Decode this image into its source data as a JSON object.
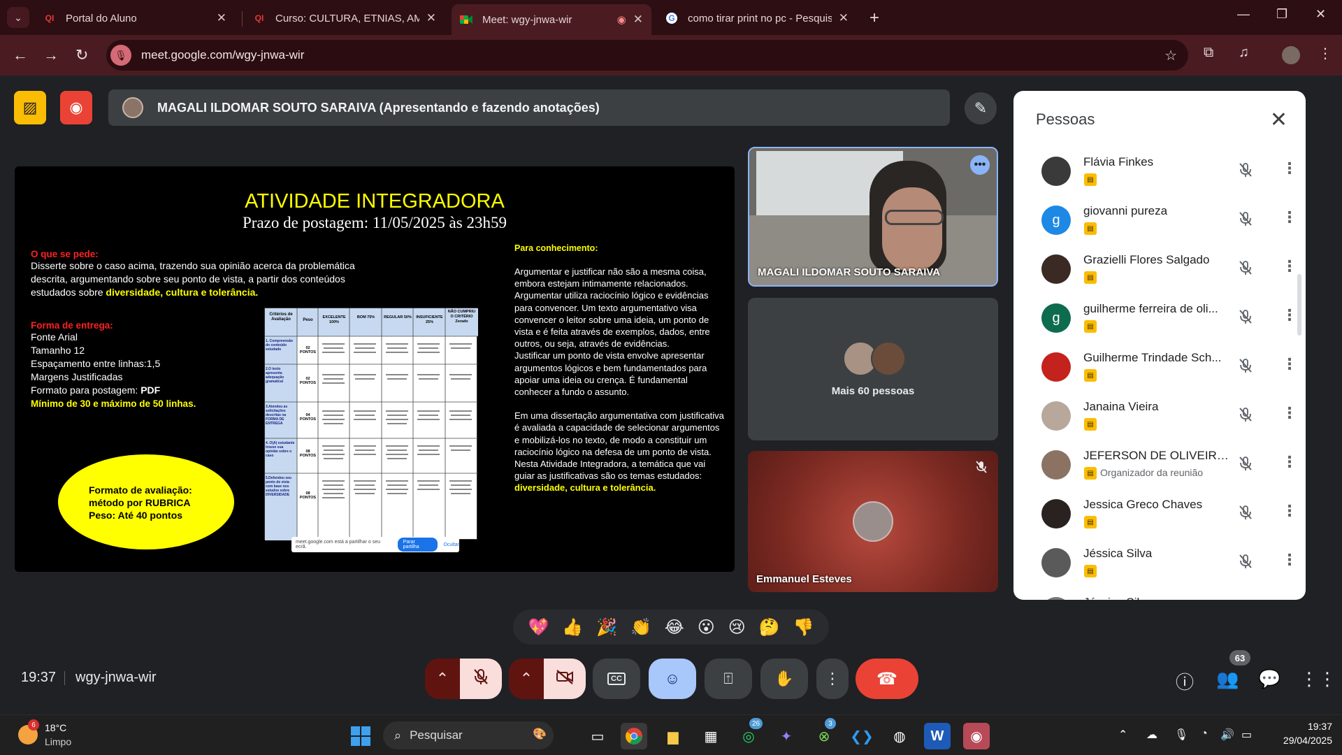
{
  "browser": {
    "tabs": [
      {
        "title": "Portal do Aluno",
        "favicon": "QI"
      },
      {
        "title": "Curso: CULTURA, ETNIAS, AMBI",
        "favicon": "QI"
      },
      {
        "title": "Meet: wgy-jnwa-wir",
        "favicon": "meet"
      },
      {
        "title": "como tirar print no pc - Pesquis",
        "favicon": "G"
      }
    ],
    "url": "meet.google.com/wgy-jnwa-wir"
  },
  "meet": {
    "presenter_text": "MAGALI ILDOMAR SOUTO SARAIVA (Apresentando e fazendo anotações)",
    "meeting_code": "wgy-jnwa-wir",
    "time": "19:37",
    "participant_count": "63"
  },
  "slide": {
    "title": "ATIVIDADE INTEGRADORA",
    "subtitle": "Prazo de postagem: 11/05/2025 às 23h59",
    "o_que_se_pede_label": "O que se pede:",
    "o_que_se_pede_text": "Disserte sobre o caso acima, trazendo sua opinião acerca da problemática descrita, argumentando sobre seu ponto de vista, a partir dos conteúdos estudados sobre",
    "o_que_se_pede_highlight": "diversidade, cultura e tolerância.",
    "forma_label": "Forma de entrega:",
    "forma_lines": [
      "Fonte Arial",
      "Tamanho 12",
      "Espaçamento entre linhas:1,5",
      "Margens Justificadas"
    ],
    "formato_postagem": "Formato para postagem:",
    "formato_postagem_value": "PDF",
    "minimo": "Mínimo de 30 e máximo de 50 linhas.",
    "avaliacao_lines": [
      "Formato de avaliação:",
      "método por RUBRICA",
      "Peso: Até 40 pontos"
    ],
    "conhecimento_label": "Para conhecimento:",
    "conhecimento_p1": "Argumentar e justificar não são a mesma coisa, embora estejam intimamente relacionados.",
    "conhecimento_p2": "Argumentar utiliza raciocínio lógico e evidências para convencer. Um texto argumentativo visa convencer o leitor sobre uma ideia, um ponto de vista e é feita através de exemplos, dados, entre outros, ou seja, através de evidências.",
    "conhecimento_p3": "Justificar um ponto de vista envolve apresentar argumentos lógicos e bem fundamentados para apoiar uma ideia ou crença. É fundamental conhecer a fundo o assunto.",
    "conhecimento_p4": "Em uma dissertação argumentativa com justificativa é avaliada a capacidade de selecionar argumentos e mobilizá-los no texto, de modo a constituir um raciocínio lógico na defesa de um ponto de vista.",
    "conhecimento_p5": "Nesta Atividade Integradora, a temática que vai guiar as justificativas são os temas estudados:",
    "conhecimento_highlight": "diversidade, cultura e tolerância.",
    "rubric_headers": [
      "Critérios de Avaliação",
      "Peso",
      "EXCELENTE 100%",
      "BOM 75%",
      "REGULAR 50%",
      "INSUFICIENTE 25%",
      "NÃO CUMPRIU O CRITÉRIO Zerado"
    ],
    "rubric_rows": [
      {
        "criterio": "1. Compreensão do conteúdo estudado",
        "peso": "02 PONTOS"
      },
      {
        "criterio": "2.O texto apresenta adequação gramatical",
        "peso": "02 PONTOS"
      },
      {
        "criterio": "3.Atendeu as solicitações descritas na FORMA DE ENTREGA",
        "peso": "04 PONTOS"
      },
      {
        "criterio": "4. O(A) estudante trouxe sua opinião sobre o caso",
        "peso": "08 PONTOS"
      },
      {
        "criterio": "5.Defendeu seu ponto de vista com base nos estudos sobre DIVERSIDADE",
        "peso": "08 PONTOS"
      }
    ],
    "share_bar_text": "meet.google.com está a partilhar o seu ecrã.",
    "share_bar_stop": "Parar partilha",
    "share_bar_hide": "Ocultar"
  },
  "tiles": {
    "presenter_name": "MAGALI ILDOMAR SOUTO SARAIVA",
    "more_people": "Mais 60 pessoas",
    "third_name": "Emmanuel Esteves"
  },
  "people_panel": {
    "title": "Pessoas",
    "people": [
      {
        "name": "Flávia Finkes",
        "role": "",
        "initial": "",
        "color": "#3a3a3a"
      },
      {
        "name": "giovanni pureza",
        "role": "",
        "initial": "g",
        "color": "#1e88e5"
      },
      {
        "name": "Grazielli Flores Salgado",
        "role": "",
        "initial": "",
        "color": "#3b2a24"
      },
      {
        "name": "guilherme ferreira de oli...",
        "role": "",
        "initial": "g",
        "color": "#0d6b4e"
      },
      {
        "name": "Guilherme Trindade Sch...",
        "role": "",
        "initial": "",
        "color": "#c4221c"
      },
      {
        "name": "Janaina Vieira",
        "role": "",
        "initial": "",
        "color": "#b8a89c"
      },
      {
        "name": "JEFERSON DE OLIVEIRA...",
        "role": "Organizador da reunião",
        "initial": "",
        "color": "#8c7262"
      },
      {
        "name": "Jessica Greco Chaves",
        "role": "",
        "initial": "",
        "color": "#2a2220"
      },
      {
        "name": "Jéssica Silva",
        "role": "",
        "initial": "",
        "color": "#5a5a5a"
      },
      {
        "name": "Jéssica Silva",
        "role": "",
        "initial": "",
        "color": "#777"
      }
    ]
  },
  "reactions": [
    "💖",
    "👍",
    "🎉",
    "👏",
    "😂",
    "😮",
    "😢",
    "🤔",
    "👎"
  ],
  "taskbar": {
    "temperature": "18°C",
    "weather": "Limpo",
    "weather_badge": "6",
    "search_placeholder": "Pesquisar",
    "whatsapp_badge": "26",
    "xbox_badge": "3",
    "time": "19:37",
    "date": "29/04/2025"
  }
}
